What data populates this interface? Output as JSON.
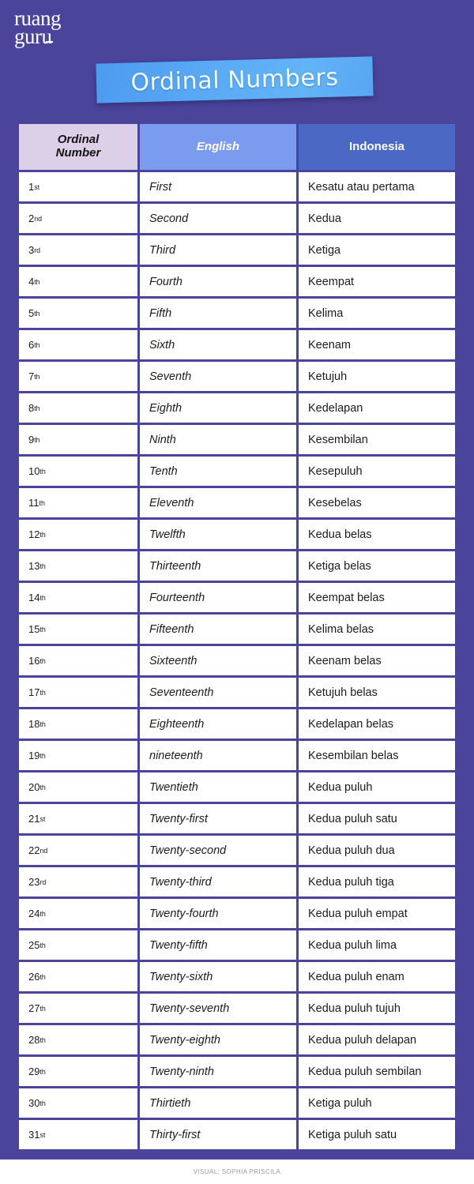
{
  "brand": {
    "logo_line_1": "ruang",
    "logo_line_2": "guru"
  },
  "title": {
    "text": "Ordinal Numbers"
  },
  "table": {
    "headers": {
      "ordinal": "Ordinal Number",
      "ordinal_line_1": "Ordinal",
      "ordinal_line_2": "Number",
      "english": "English",
      "indonesia": "Indonesia"
    },
    "rows": [
      {
        "num": "1",
        "suffix": "st",
        "english": "First",
        "indonesia": "Kesatu atau pertama"
      },
      {
        "num": "2",
        "suffix": "nd",
        "english": "Second",
        "indonesia": "Kedua"
      },
      {
        "num": "3",
        "suffix": "rd",
        "english": "Third",
        "indonesia": "Ketiga"
      },
      {
        "num": "4",
        "suffix": "th",
        "english": "Fourth",
        "indonesia": "Keempat"
      },
      {
        "num": "5",
        "suffix": "th",
        "english": "Fifth",
        "indonesia": "Kelima"
      },
      {
        "num": "6",
        "suffix": "th",
        "english": "Sixth",
        "indonesia": "Keenam"
      },
      {
        "num": "7",
        "suffix": "th",
        "english": "Seventh",
        "indonesia": "Ketujuh"
      },
      {
        "num": "8",
        "suffix": "th",
        "english": "Eighth",
        "indonesia": "Kedelapan"
      },
      {
        "num": "9",
        "suffix": "th",
        "english": "Ninth",
        "indonesia": "Kesembilan"
      },
      {
        "num": "10",
        "suffix": "th",
        "english": "Tenth",
        "indonesia": "Kesepuluh"
      },
      {
        "num": "11",
        "suffix": "th",
        "english": "Eleventh",
        "indonesia": "Kesebelas"
      },
      {
        "num": "12",
        "suffix": "th",
        "english": "Twelfth",
        "indonesia": "Kedua belas"
      },
      {
        "num": "13",
        "suffix": "th",
        "english": "Thirteenth",
        "indonesia": "Ketiga belas"
      },
      {
        "num": "14",
        "suffix": "th",
        "english": "Fourteenth",
        "indonesia": "Keempat belas"
      },
      {
        "num": "15",
        "suffix": "th",
        "english": "Fifteenth",
        "indonesia": "Kelima belas"
      },
      {
        "num": "16",
        "suffix": "th",
        "english": "Sixteenth",
        "indonesia": "Keenam belas"
      },
      {
        "num": "17",
        "suffix": "th",
        "english": "Seventeenth",
        "indonesia": "Ketujuh belas"
      },
      {
        "num": "18",
        "suffix": "th",
        "english": "Eighteenth",
        "indonesia": "Kedelapan belas"
      },
      {
        "num": "19",
        "suffix": "th",
        "english": "nineteenth",
        "indonesia": "Kesembilan belas"
      },
      {
        "num": "20",
        "suffix": "th",
        "english": "Twentieth",
        "indonesia": "Kedua puluh"
      },
      {
        "num": "21",
        "suffix": "st",
        "english": "Twenty-first",
        "indonesia": "Kedua puluh satu"
      },
      {
        "num": "22",
        "suffix": "nd",
        "english": "Twenty-second",
        "indonesia": "Kedua puluh dua"
      },
      {
        "num": "23",
        "suffix": "rd",
        "english": "Twenty-third",
        "indonesia": "Kedua puluh tiga"
      },
      {
        "num": "24",
        "suffix": "th",
        "english": "Twenty-fourth",
        "indonesia": "Kedua puluh empat"
      },
      {
        "num": "25",
        "suffix": "th",
        "english": "Twenty-fifth",
        "indonesia": "Kedua puluh lima"
      },
      {
        "num": "26",
        "suffix": "th",
        "english": "Twenty-sixth",
        "indonesia": "Kedua puluh enam"
      },
      {
        "num": "27",
        "suffix": "th",
        "english": "Twenty-seventh",
        "indonesia": "Kedua puluh tujuh"
      },
      {
        "num": "28",
        "suffix": "th",
        "english": "Twenty-eighth",
        "indonesia": "Kedua puluh delapan"
      },
      {
        "num": "29",
        "suffix": "th",
        "english": "Twenty-ninth",
        "indonesia": "Kedua puluh sembilan"
      },
      {
        "num": "30",
        "suffix": "th",
        "english": "Thirtieth",
        "indonesia": "Ketiga puluh"
      },
      {
        "num": "31",
        "suffix": "st",
        "english": "Thirty-first",
        "indonesia": "Ketiga puluh satu"
      }
    ]
  },
  "footer": {
    "credit": "VISUAL: SOPHIA PRISCILA"
  },
  "colors": {
    "background": "#4a459b",
    "header_ordinal": "#dccfe8",
    "header_english": "#7b9bee",
    "header_indonesia": "#4a68c4",
    "cell_background": "#ffffff",
    "title_banner": "#57a6f2"
  }
}
